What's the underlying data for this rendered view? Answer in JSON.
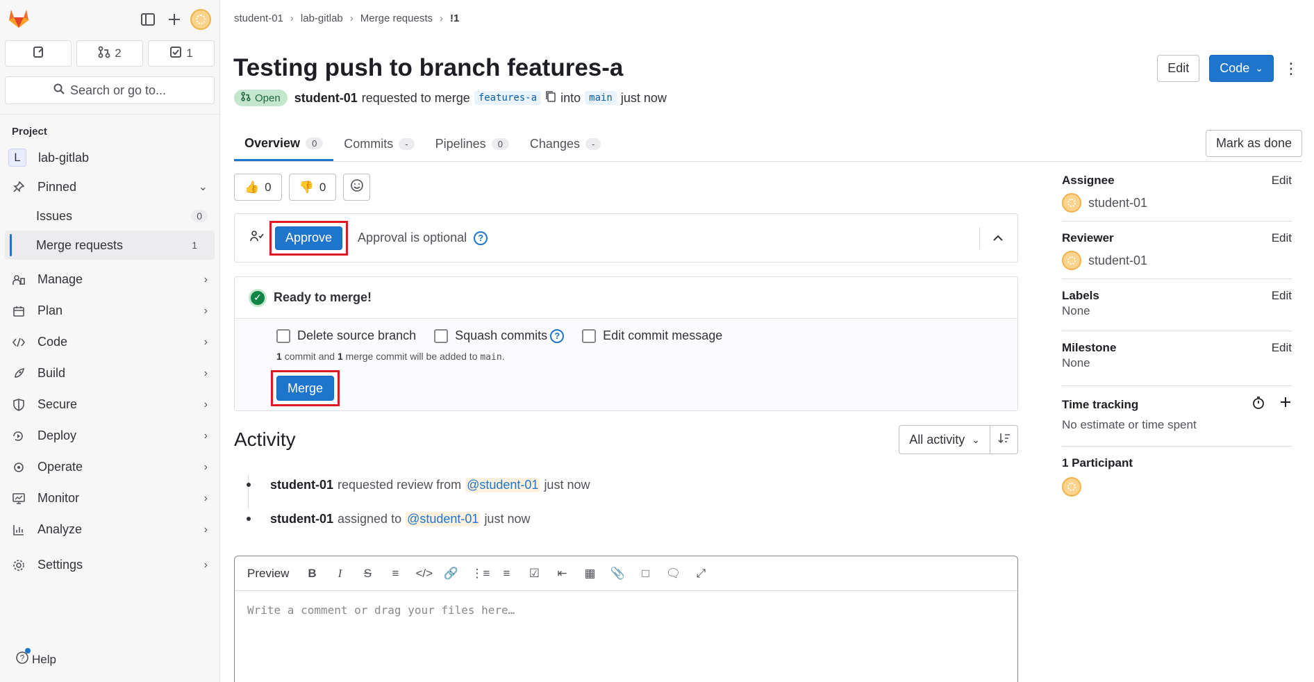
{
  "sidebar": {
    "counters": {
      "merge_requests": "2",
      "todos": "1"
    },
    "search_label": "Search or go to...",
    "section_title": "Project",
    "project": {
      "initial": "L",
      "name": "lab-gitlab"
    },
    "pinned_label": "Pinned",
    "pinned_items": [
      {
        "label": "Issues",
        "count": "0"
      },
      {
        "label": "Merge requests",
        "count": "1"
      }
    ],
    "nav": [
      "Manage",
      "Plan",
      "Code",
      "Build",
      "Secure",
      "Deploy",
      "Operate",
      "Monitor",
      "Analyze"
    ],
    "settings_label": "Settings",
    "help_label": "Help"
  },
  "breadcrumb": [
    "student-01",
    "lab-gitlab",
    "Merge requests",
    "!1"
  ],
  "mr": {
    "title": "Testing push to branch features-a",
    "status": "Open",
    "author": "student-01",
    "requested_text": "requested to merge",
    "source_branch": "features-a",
    "into_text": "into",
    "target_branch": "main",
    "time": "just now"
  },
  "header_buttons": {
    "edit": "Edit",
    "code": "Code"
  },
  "tabs": [
    {
      "label": "Overview",
      "count": "0"
    },
    {
      "label": "Commits",
      "count": "-"
    },
    {
      "label": "Pipelines",
      "count": "0"
    },
    {
      "label": "Changes",
      "count": "-"
    }
  ],
  "mark_done_label": "Mark as done",
  "reactions": {
    "thumbs_up": "0",
    "thumbs_down": "0"
  },
  "approval": {
    "button": "Approve",
    "text": "Approval is optional"
  },
  "merge": {
    "status": "Ready to merge!",
    "options": [
      "Delete source branch",
      "Squash commits",
      "Edit commit message"
    ],
    "note": {
      "commits": "1",
      "commit_word": "commit and",
      "merge_commits": "1",
      "merge_word": "merge commit will be added to",
      "branch": "main",
      "end": "."
    },
    "button": "Merge"
  },
  "activity": {
    "title": "Activity",
    "filter": "All activity",
    "items": [
      {
        "who": "student-01",
        "action": "requested review from",
        "mention": "@student-01",
        "time": "just now"
      },
      {
        "who": "student-01",
        "action": "assigned to",
        "mention": "@student-01",
        "time": "just now"
      }
    ]
  },
  "editor": {
    "preview": "Preview",
    "placeholder": "Write a comment or drag your files here…"
  },
  "right_sidebar": {
    "assignee": {
      "label": "Assignee",
      "edit": "Edit",
      "user": "student-01"
    },
    "reviewer": {
      "label": "Reviewer",
      "edit": "Edit",
      "user": "student-01"
    },
    "labels": {
      "label": "Labels",
      "edit": "Edit",
      "value": "None"
    },
    "milestone": {
      "label": "Milestone",
      "edit": "Edit",
      "value": "None"
    },
    "time_tracking": {
      "label": "Time tracking",
      "value": "No estimate or time spent"
    },
    "participants": {
      "label": "1 Participant"
    }
  }
}
